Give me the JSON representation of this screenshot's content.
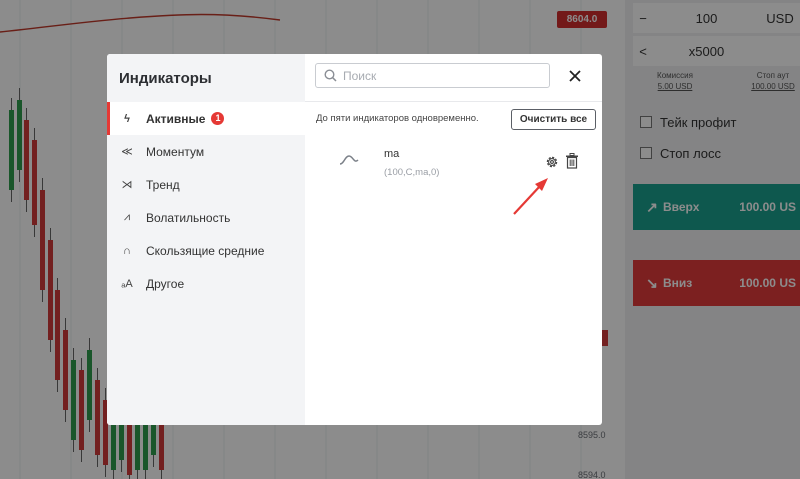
{
  "background": {
    "price_tag": "8604.0",
    "axis_labels": [
      "8595.0",
      "8594.0"
    ],
    "right_panel": {
      "amount": {
        "minus": "−",
        "value": "100",
        "currency": "USD"
      },
      "multiplier": {
        "back": "<",
        "value": "x5000"
      },
      "commission": {
        "label": "Комиссия",
        "value": "5.00 USD"
      },
      "stop_out": {
        "label": "Стоп аут",
        "value": "100.00 USD"
      },
      "take_profit": "Тейк профит",
      "stop_loss": "Стоп лосс",
      "up": {
        "label": "Вверх",
        "amount": "100.00 US"
      },
      "down": {
        "label": "Вниз",
        "amount": "100.00 US"
      }
    }
  },
  "modal": {
    "title": "Индикаторы",
    "categories": [
      {
        "label": "Активные",
        "icon": "lightning-icon",
        "badge": "1",
        "active": true
      },
      {
        "label": "Моментум",
        "icon": "momentum-icon"
      },
      {
        "label": "Тренд",
        "icon": "trend-icon"
      },
      {
        "label": "Волатильность",
        "icon": "volatility-icon"
      },
      {
        "label": "Скользящие средние",
        "icon": "moving-average-icon"
      },
      {
        "label": "Другое",
        "icon": "other-icon"
      }
    ],
    "search": {
      "placeholder": "Поиск",
      "value": ""
    },
    "hint": "До пяти индикаторов одновременно.",
    "clear_all": "Очистить все",
    "indicators": [
      {
        "name": "ma",
        "params": "(100,C,ma,0)",
        "icon": "wave-icon"
      }
    ]
  },
  "annotation_color": "#e53935"
}
